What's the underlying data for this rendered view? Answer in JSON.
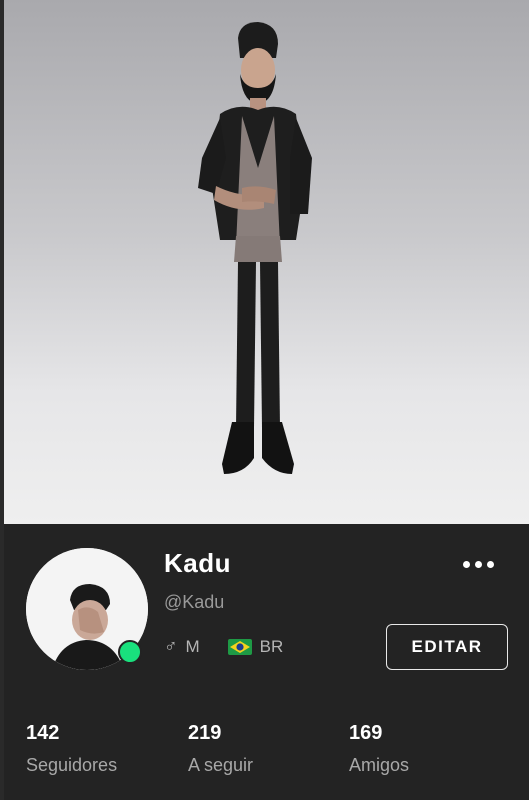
{
  "profile": {
    "name": "Kadu",
    "username": "@Kadu",
    "gender_symbol": "♂",
    "gender": "M",
    "country": "BR",
    "status": "online"
  },
  "actions": {
    "edit_label": "EDITAR"
  },
  "stats": [
    {
      "value": "142",
      "label": "Seguidores"
    },
    {
      "value": "219",
      "label": "A seguir"
    },
    {
      "value": "169",
      "label": "Amigos"
    }
  ],
  "icons": {
    "more": "more-horizontal-icon",
    "gender": "male-icon",
    "flag": "brazil-flag-icon"
  },
  "colors": {
    "background": "#232323",
    "online": "#19e07d",
    "muted_text": "#a8a8a8"
  }
}
